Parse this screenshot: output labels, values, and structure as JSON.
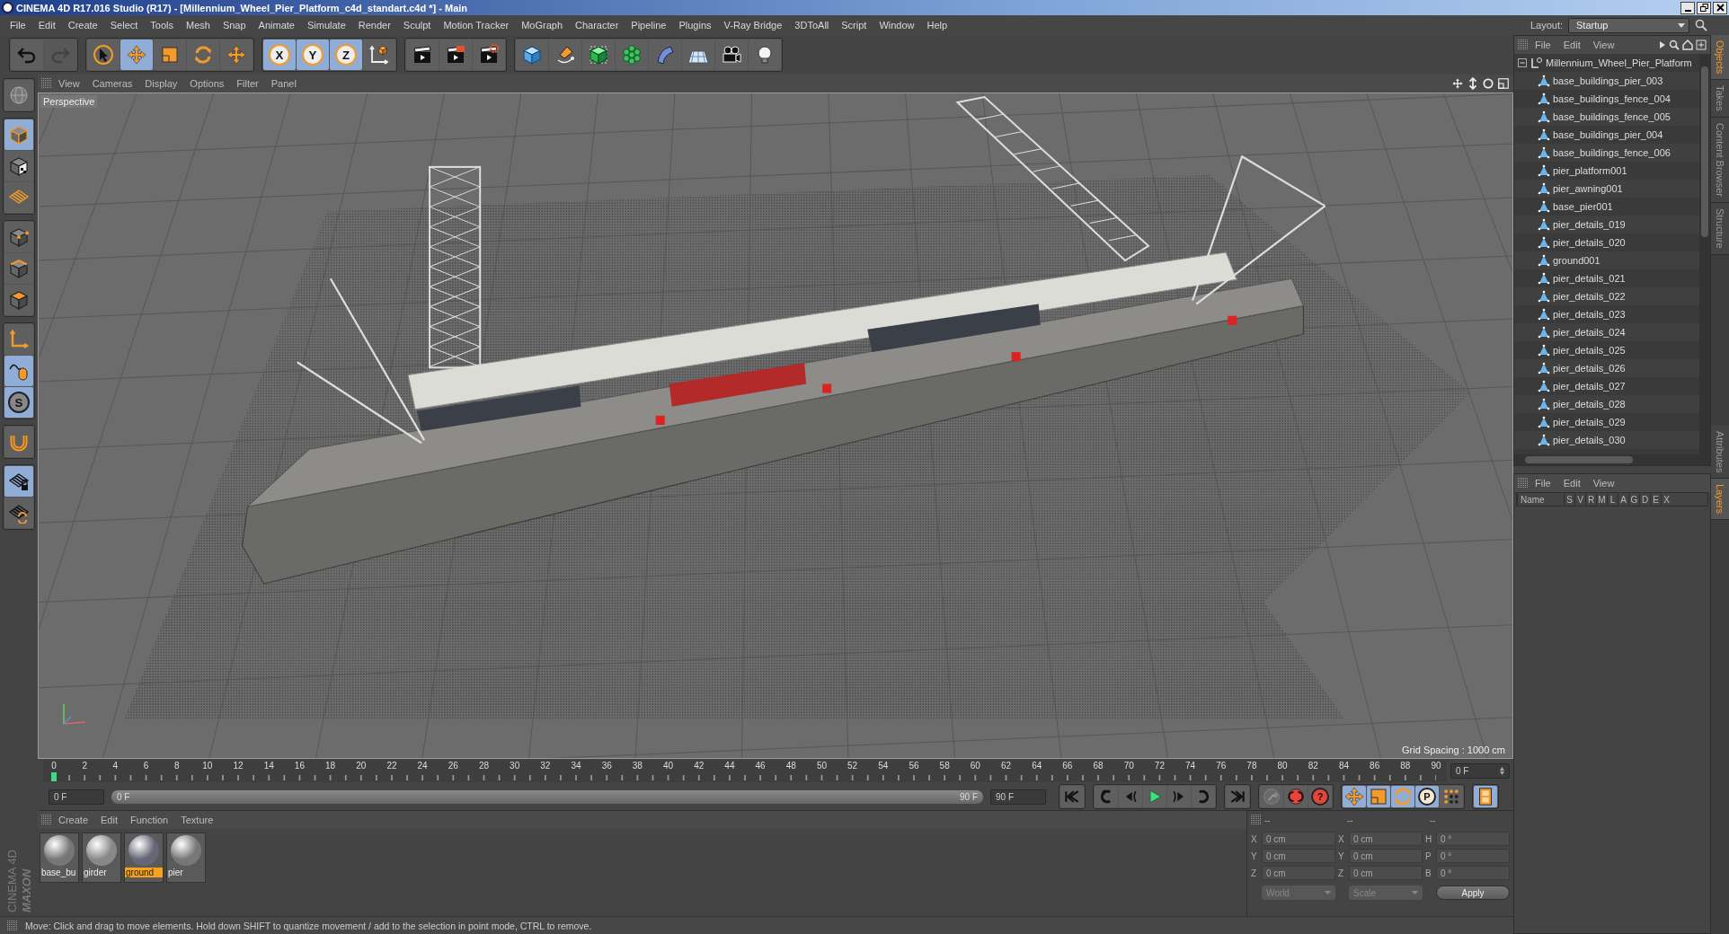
{
  "window": {
    "title": "CINEMA 4D R17.016 Studio (R17) - [Millennium_Wheel_Pier_Platform_c4d_standart.c4d *] - Main"
  },
  "menu_bar": [
    "File",
    "Edit",
    "Create",
    "Select",
    "Tools",
    "Mesh",
    "Snap",
    "Animate",
    "Simulate",
    "Render",
    "Sculpt",
    "Motion Tracker",
    "MoGraph",
    "Character",
    "Pipeline",
    "Plugins",
    "V-Ray Bridge",
    "3DToAll",
    "Script",
    "Window",
    "Help"
  ],
  "layout": {
    "label": "Layout:",
    "value": "Startup"
  },
  "toolbar": [
    [
      {
        "kind": "undo",
        "selected": false,
        "disabled": false
      },
      {
        "kind": "redo",
        "selected": false,
        "disabled": true
      }
    ],
    [
      {
        "kind": "select",
        "selected": false,
        "disabled": false
      },
      {
        "kind": "move",
        "selected": true,
        "disabled": false
      },
      {
        "kind": "scale",
        "selected": false,
        "disabled": false
      },
      {
        "kind": "rotate",
        "selected": false,
        "disabled": false
      },
      {
        "kind": "transform",
        "selected": false,
        "disabled": false
      }
    ],
    [
      {
        "kind": "axis",
        "label": "X",
        "selected": true,
        "disabled": false
      },
      {
        "kind": "axis",
        "label": "Y",
        "selected": true,
        "disabled": false
      },
      {
        "kind": "axis",
        "label": "Z",
        "selected": true,
        "disabled": false
      },
      {
        "kind": "coords",
        "selected": false,
        "disabled": false
      }
    ],
    [
      {
        "kind": "render_view",
        "selected": false,
        "disabled": false
      },
      {
        "kind": "render",
        "selected": false,
        "disabled": false
      },
      {
        "kind": "render_settings",
        "selected": false,
        "disabled": false
      }
    ],
    [
      {
        "kind": "cube",
        "selected": false,
        "disabled": false
      },
      {
        "kind": "pen",
        "selected": false,
        "disabled": false
      },
      {
        "kind": "subdivision",
        "selected": false,
        "disabled": false
      },
      {
        "kind": "array",
        "selected": false,
        "disabled": false
      },
      {
        "kind": "deformer",
        "selected": false,
        "disabled": false
      },
      {
        "kind": "floor",
        "selected": false,
        "disabled": false
      },
      {
        "kind": "camera",
        "selected": false,
        "disabled": false
      },
      {
        "kind": "light",
        "selected": false,
        "disabled": false
      }
    ]
  ],
  "tool_strip": [
    [
      {
        "kind": "editable",
        "selected": false
      }
    ],
    [
      {
        "kind": "model",
        "selected": true
      },
      {
        "kind": "texture",
        "selected": false
      },
      {
        "kind": "workplane",
        "selected": false
      }
    ],
    [
      {
        "kind": "points",
        "selected": false
      },
      {
        "kind": "edges",
        "selected": false
      },
      {
        "kind": "polygons",
        "selected": false
      }
    ],
    [
      {
        "kind": "axis_mode",
        "selected": false
      },
      {
        "kind": "tweak",
        "selected": true
      },
      {
        "kind": "snap",
        "label": "S",
        "selected": true
      }
    ],
    [
      {
        "kind": "magnet",
        "selected": false
      }
    ],
    [
      {
        "kind": "grid_lock",
        "selected": true
      },
      {
        "kind": "grid_sync",
        "selected": false
      }
    ]
  ],
  "viewport": {
    "menu": [
      "View",
      "Cameras",
      "Display",
      "Options",
      "Filter",
      "Panel"
    ],
    "camera": "Perspective",
    "grid_spacing": "Grid Spacing : 1000 cm"
  },
  "timeline": {
    "ticks": [
      "0",
      "2",
      "4",
      "6",
      "8",
      "10",
      "12",
      "14",
      "16",
      "18",
      "20",
      "22",
      "24",
      "26",
      "28",
      "30",
      "32",
      "34",
      "36",
      "38",
      "40",
      "42",
      "44",
      "46",
      "48",
      "50",
      "52",
      "54",
      "56",
      "58",
      "60",
      "62",
      "64",
      "66",
      "68",
      "70",
      "72",
      "74",
      "76",
      "78",
      "80",
      "82",
      "84",
      "86",
      "88",
      "90"
    ],
    "playhead": {
      "level": 0
    },
    "current_frame": "0 F",
    "start_field": "0 F",
    "range_start": "0 F",
    "range_end": "90 F",
    "range": {
      "level": 1
    },
    "end_field": "90 F",
    "transport": [
      [
        {
          "kind": "to_start",
          "selected": false
        }
      ],
      [
        {
          "kind": "prev_key",
          "selected": false
        },
        {
          "kind": "prev_frame",
          "selected": false
        },
        {
          "kind": "play",
          "selected": false
        },
        {
          "kind": "next_frame",
          "selected": false
        },
        {
          "kind": "next_key",
          "selected": false
        }
      ],
      [
        {
          "kind": "to_end",
          "selected": false
        }
      ],
      [
        {
          "kind": "key",
          "selected": false
        },
        {
          "kind": "record",
          "selected": false
        },
        {
          "kind": "autokey",
          "label": "?",
          "selected": false
        }
      ],
      [
        {
          "kind": "move",
          "selected": true
        },
        {
          "kind": "scale",
          "selected": true
        },
        {
          "kind": "rotate",
          "selected": true
        },
        {
          "kind": "param",
          "label": "P",
          "selected": true
        },
        {
          "kind": "points_grid",
          "selected": false
        }
      ],
      [
        {
          "kind": "film",
          "selected": true
        }
      ]
    ]
  },
  "materials": {
    "menu": [
      "Create",
      "Edit",
      "Function",
      "Texture"
    ],
    "items": [
      {
        "name": "base_bu",
        "selected": false
      },
      {
        "name": "girder",
        "selected": false
      },
      {
        "name": "ground",
        "selected": true
      },
      {
        "name": "pier",
        "selected": false
      }
    ]
  },
  "coordinates": {
    "headers": [
      "--",
      "--",
      "--"
    ],
    "rows": [
      [
        {
          "axis": "X",
          "value": "0 cm"
        },
        {
          "axis": "X",
          "value": "0 cm"
        },
        {
          "axis": "H",
          "value": "0 °"
        }
      ],
      [
        {
          "axis": "Y",
          "value": "0 cm"
        },
        {
          "axis": "Y",
          "value": "0 cm"
        },
        {
          "axis": "P",
          "value": "0 °"
        }
      ],
      [
        {
          "axis": "Z",
          "value": "0 cm"
        },
        {
          "axis": "Z",
          "value": "0 cm"
        },
        {
          "axis": "B",
          "value": "0 °"
        }
      ]
    ],
    "mode": "World",
    "transform": "Scale",
    "apply": "Apply"
  },
  "logo": {
    "brand": "MAXON",
    "product": "CINEMA 4D"
  },
  "status_bar": "Move: Click and drag to move elements. Hold down SHIFT to quantize movement / add to the selection in point mode, CTRL to remove.",
  "objects_panel": {
    "menu": [
      "File",
      "Edit",
      "View"
    ],
    "root": {
      "name": "Millennium_Wheel_Pier_Platform",
      "expanded": true,
      "children": [
        {
          "name": "base_buildings_pier_003"
        },
        {
          "name": "base_buildings_fence_004"
        },
        {
          "name": "base_buildings_fence_005"
        },
        {
          "name": "base_buildings_pier_004"
        },
        {
          "name": "base_buildings_fence_006"
        },
        {
          "name": "pier_platform001"
        },
        {
          "name": "pier_awning001"
        },
        {
          "name": "base_pier001"
        },
        {
          "name": "pier_details_019"
        },
        {
          "name": "pier_details_020"
        },
        {
          "name": "ground001"
        },
        {
          "name": "pier_details_021"
        },
        {
          "name": "pier_details_022"
        },
        {
          "name": "pier_details_023"
        },
        {
          "name": "pier_details_024"
        },
        {
          "name": "pier_details_025"
        },
        {
          "name": "pier_details_026"
        },
        {
          "name": "pier_details_027"
        },
        {
          "name": "pier_details_028"
        },
        {
          "name": "pier_details_029"
        },
        {
          "name": "pier_details_030"
        }
      ]
    }
  },
  "layers_panel": {
    "menu": [
      "File",
      "Edit",
      "View"
    ],
    "columns": [
      "Name",
      "S",
      "V",
      "R",
      "M",
      "L",
      "A",
      "G",
      "D",
      "E",
      "X"
    ]
  },
  "side_tabs": {
    "upper": [
      {
        "label": "Objects",
        "selected": true
      },
      {
        "label": "Takes",
        "selected": false
      },
      {
        "label": "Content Browser",
        "selected": false
      },
      {
        "label": "Structure",
        "selected": false
      }
    ],
    "lower": [
      {
        "label": "Attributes",
        "selected": false
      },
      {
        "label": "Layers",
        "selected": true
      }
    ]
  }
}
